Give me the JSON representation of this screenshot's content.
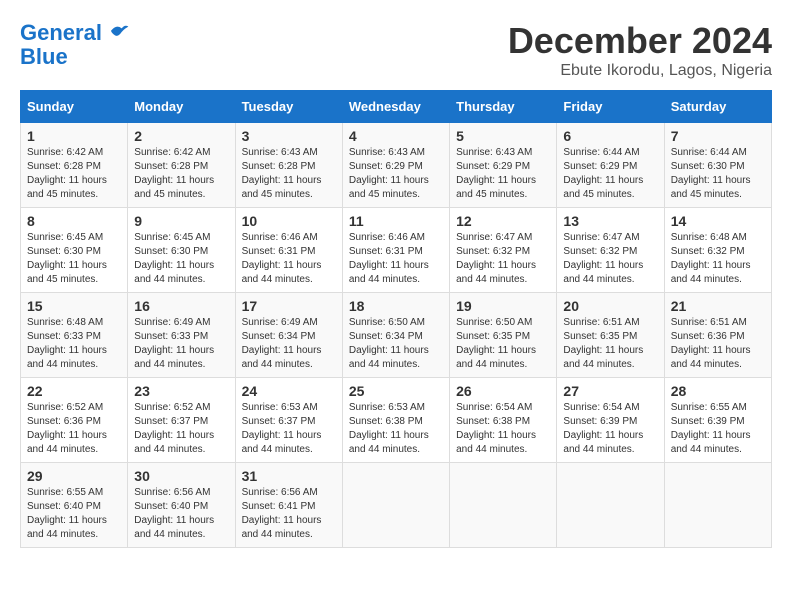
{
  "logo": {
    "line1": "General",
    "line2": "Blue"
  },
  "title": "December 2024",
  "subtitle": "Ebute Ikorodu, Lagos, Nigeria",
  "days_of_week": [
    "Sunday",
    "Monday",
    "Tuesday",
    "Wednesday",
    "Thursday",
    "Friday",
    "Saturday"
  ],
  "weeks": [
    [
      {
        "day": "1",
        "info": "Sunrise: 6:42 AM\nSunset: 6:28 PM\nDaylight: 11 hours\nand 45 minutes."
      },
      {
        "day": "2",
        "info": "Sunrise: 6:42 AM\nSunset: 6:28 PM\nDaylight: 11 hours\nand 45 minutes."
      },
      {
        "day": "3",
        "info": "Sunrise: 6:43 AM\nSunset: 6:28 PM\nDaylight: 11 hours\nand 45 minutes."
      },
      {
        "day": "4",
        "info": "Sunrise: 6:43 AM\nSunset: 6:29 PM\nDaylight: 11 hours\nand 45 minutes."
      },
      {
        "day": "5",
        "info": "Sunrise: 6:43 AM\nSunset: 6:29 PM\nDaylight: 11 hours\nand 45 minutes."
      },
      {
        "day": "6",
        "info": "Sunrise: 6:44 AM\nSunset: 6:29 PM\nDaylight: 11 hours\nand 45 minutes."
      },
      {
        "day": "7",
        "info": "Sunrise: 6:44 AM\nSunset: 6:30 PM\nDaylight: 11 hours\nand 45 minutes."
      }
    ],
    [
      {
        "day": "8",
        "info": "Sunrise: 6:45 AM\nSunset: 6:30 PM\nDaylight: 11 hours\nand 45 minutes."
      },
      {
        "day": "9",
        "info": "Sunrise: 6:45 AM\nSunset: 6:30 PM\nDaylight: 11 hours\nand 44 minutes."
      },
      {
        "day": "10",
        "info": "Sunrise: 6:46 AM\nSunset: 6:31 PM\nDaylight: 11 hours\nand 44 minutes."
      },
      {
        "day": "11",
        "info": "Sunrise: 6:46 AM\nSunset: 6:31 PM\nDaylight: 11 hours\nand 44 minutes."
      },
      {
        "day": "12",
        "info": "Sunrise: 6:47 AM\nSunset: 6:32 PM\nDaylight: 11 hours\nand 44 minutes."
      },
      {
        "day": "13",
        "info": "Sunrise: 6:47 AM\nSunset: 6:32 PM\nDaylight: 11 hours\nand 44 minutes."
      },
      {
        "day": "14",
        "info": "Sunrise: 6:48 AM\nSunset: 6:32 PM\nDaylight: 11 hours\nand 44 minutes."
      }
    ],
    [
      {
        "day": "15",
        "info": "Sunrise: 6:48 AM\nSunset: 6:33 PM\nDaylight: 11 hours\nand 44 minutes."
      },
      {
        "day": "16",
        "info": "Sunrise: 6:49 AM\nSunset: 6:33 PM\nDaylight: 11 hours\nand 44 minutes."
      },
      {
        "day": "17",
        "info": "Sunrise: 6:49 AM\nSunset: 6:34 PM\nDaylight: 11 hours\nand 44 minutes."
      },
      {
        "day": "18",
        "info": "Sunrise: 6:50 AM\nSunset: 6:34 PM\nDaylight: 11 hours\nand 44 minutes."
      },
      {
        "day": "19",
        "info": "Sunrise: 6:50 AM\nSunset: 6:35 PM\nDaylight: 11 hours\nand 44 minutes."
      },
      {
        "day": "20",
        "info": "Sunrise: 6:51 AM\nSunset: 6:35 PM\nDaylight: 11 hours\nand 44 minutes."
      },
      {
        "day": "21",
        "info": "Sunrise: 6:51 AM\nSunset: 6:36 PM\nDaylight: 11 hours\nand 44 minutes."
      }
    ],
    [
      {
        "day": "22",
        "info": "Sunrise: 6:52 AM\nSunset: 6:36 PM\nDaylight: 11 hours\nand 44 minutes."
      },
      {
        "day": "23",
        "info": "Sunrise: 6:52 AM\nSunset: 6:37 PM\nDaylight: 11 hours\nand 44 minutes."
      },
      {
        "day": "24",
        "info": "Sunrise: 6:53 AM\nSunset: 6:37 PM\nDaylight: 11 hours\nand 44 minutes."
      },
      {
        "day": "25",
        "info": "Sunrise: 6:53 AM\nSunset: 6:38 PM\nDaylight: 11 hours\nand 44 minutes."
      },
      {
        "day": "26",
        "info": "Sunrise: 6:54 AM\nSunset: 6:38 PM\nDaylight: 11 hours\nand 44 minutes."
      },
      {
        "day": "27",
        "info": "Sunrise: 6:54 AM\nSunset: 6:39 PM\nDaylight: 11 hours\nand 44 minutes."
      },
      {
        "day": "28",
        "info": "Sunrise: 6:55 AM\nSunset: 6:39 PM\nDaylight: 11 hours\nand 44 minutes."
      }
    ],
    [
      {
        "day": "29",
        "info": "Sunrise: 6:55 AM\nSunset: 6:40 PM\nDaylight: 11 hours\nand 44 minutes."
      },
      {
        "day": "30",
        "info": "Sunrise: 6:56 AM\nSunset: 6:40 PM\nDaylight: 11 hours\nand 44 minutes."
      },
      {
        "day": "31",
        "info": "Sunrise: 6:56 AM\nSunset: 6:41 PM\nDaylight: 11 hours\nand 44 minutes."
      },
      {
        "day": "",
        "info": ""
      },
      {
        "day": "",
        "info": ""
      },
      {
        "day": "",
        "info": ""
      },
      {
        "day": "",
        "info": ""
      }
    ]
  ]
}
